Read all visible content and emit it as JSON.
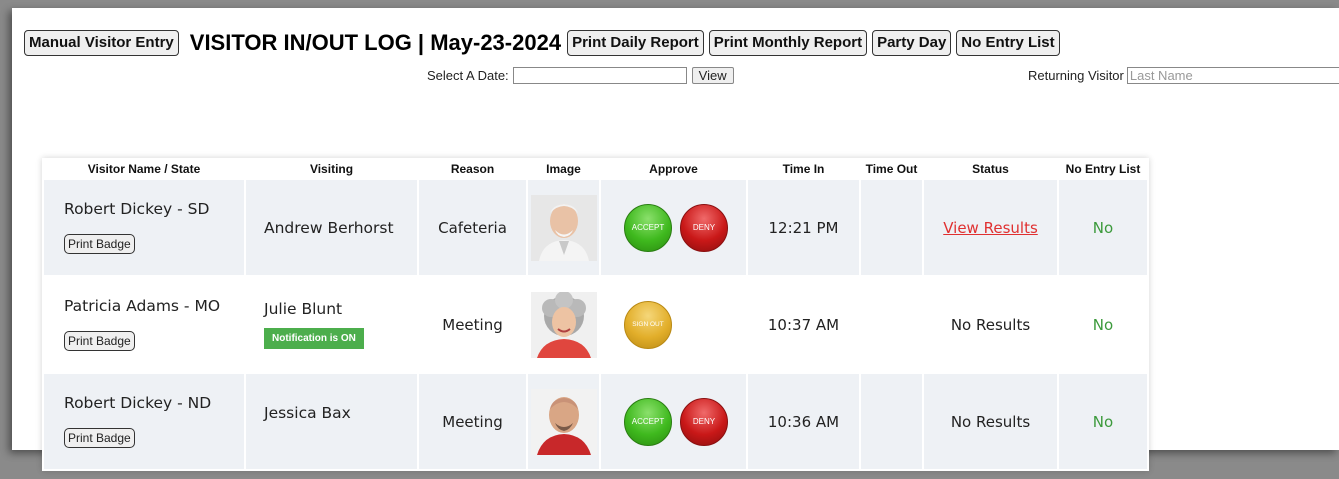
{
  "header": {
    "manual_entry_label": "Manual Visitor Entry",
    "title": "VISITOR IN/OUT LOG | May-23-2024",
    "buttons": [
      "Print Daily Report",
      "Print Monthly Report",
      "Party Day",
      "No Entry List"
    ]
  },
  "date_filter": {
    "label": "Select A Date:",
    "value": "",
    "view_label": "View"
  },
  "returning": {
    "label": "Returning Visitor",
    "placeholder": "Last Name"
  },
  "table": {
    "columns": [
      "Visitor Name / State",
      "Visiting",
      "Reason",
      "Image",
      "Approve",
      "Time In",
      "Time Out",
      "Status",
      "No Entry List"
    ],
    "rows": [
      {
        "name": "Robert Dickey - SD",
        "badge_label": "Print Badge",
        "visiting": "Andrew Berhorst",
        "notification": "",
        "reason": "Cafeteria",
        "approve": [
          "ACCEPT",
          "DENY"
        ],
        "time_in": "12:21 PM",
        "time_out": "",
        "status": "View Results",
        "no_entry": "No"
      },
      {
        "name": "Patricia Adams - MO",
        "badge_label": "Print Badge",
        "visiting": "Julie Blunt",
        "notification": "Notification is ON",
        "reason": "Meeting",
        "approve": [
          "SIGN OUT"
        ],
        "time_in": "10:37 AM",
        "time_out": "",
        "status": "No Results",
        "no_entry": "No"
      },
      {
        "name": "Robert Dickey - ND",
        "badge_label": "Print Badge",
        "visiting": "Jessica Bax",
        "notification": "",
        "reason": "Meeting",
        "approve": [
          "ACCEPT",
          "DENY"
        ],
        "time_in": "10:36 AM",
        "time_out": "",
        "status": "No Results",
        "no_entry": "No"
      }
    ]
  },
  "colors": {
    "accept": "#3fb91e",
    "deny": "#c91818",
    "signout": "#e2ae2a",
    "notification": "#4cae4c",
    "link_red": "#e03030",
    "no_green": "#3c9a3c"
  }
}
